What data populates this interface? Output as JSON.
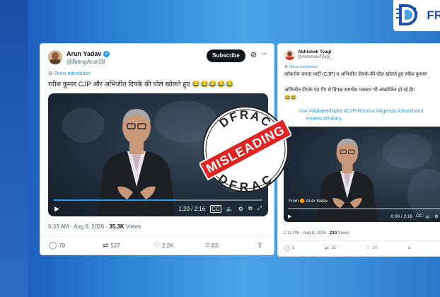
{
  "brand": {
    "logo_text": "FR"
  },
  "tweet1": {
    "name": "Arun Yadav",
    "handle": "@BeingArun28",
    "subscribe": "Subscribe",
    "translate": "Show translation",
    "text": "रवीश कुमार CJP और अभिजीत दिपके की पोल खोलते हुए 😂😂😂😂😂",
    "video_time": "1:20 / 2:16",
    "timestamp": "6:33 AM · Aug 8, 2026 · ",
    "views_count": "35.3K",
    "views_label": " Views",
    "replies": "70",
    "retweets": "527",
    "likes": "2.2K",
    "bookmarks": "83"
  },
  "tweet2": {
    "name": "Abhishek Tyagi",
    "handle": "@AbhishekTyagi_",
    "translate": "Show translation",
    "text_line1": "कॉकरोच जनता पार्टी (CJP) व अभिजीत दीपके की पोल खोलते हुए रवीश कुमार!",
    "text_line2": "अभिजीत दीपके एंड गैंग से विपक्ष समर्थक पत्रकार भी आक्रोशित हो रहे है!!",
    "emoji": "😂😂",
    "hashtags_line1": "mar #AbhijeetDipke #CJP #Drama #Agenda #Jharkhand",
    "hashtags_line2": "Protest #Politics",
    "video_from": "From 🟠 Arun Yadav",
    "video_time": "0:00 / 2:16",
    "timestamp": "1:12 PM · Aug 8, 2026 · ",
    "views_count": "210",
    "views_label": " Views",
    "replies": "1",
    "retweets": "15",
    "likes": "14"
  },
  "stamp": {
    "top_text": "DFRAC",
    "bottom_text": "DFRAC",
    "label": "MISLEADING",
    "color": "#e02424"
  }
}
